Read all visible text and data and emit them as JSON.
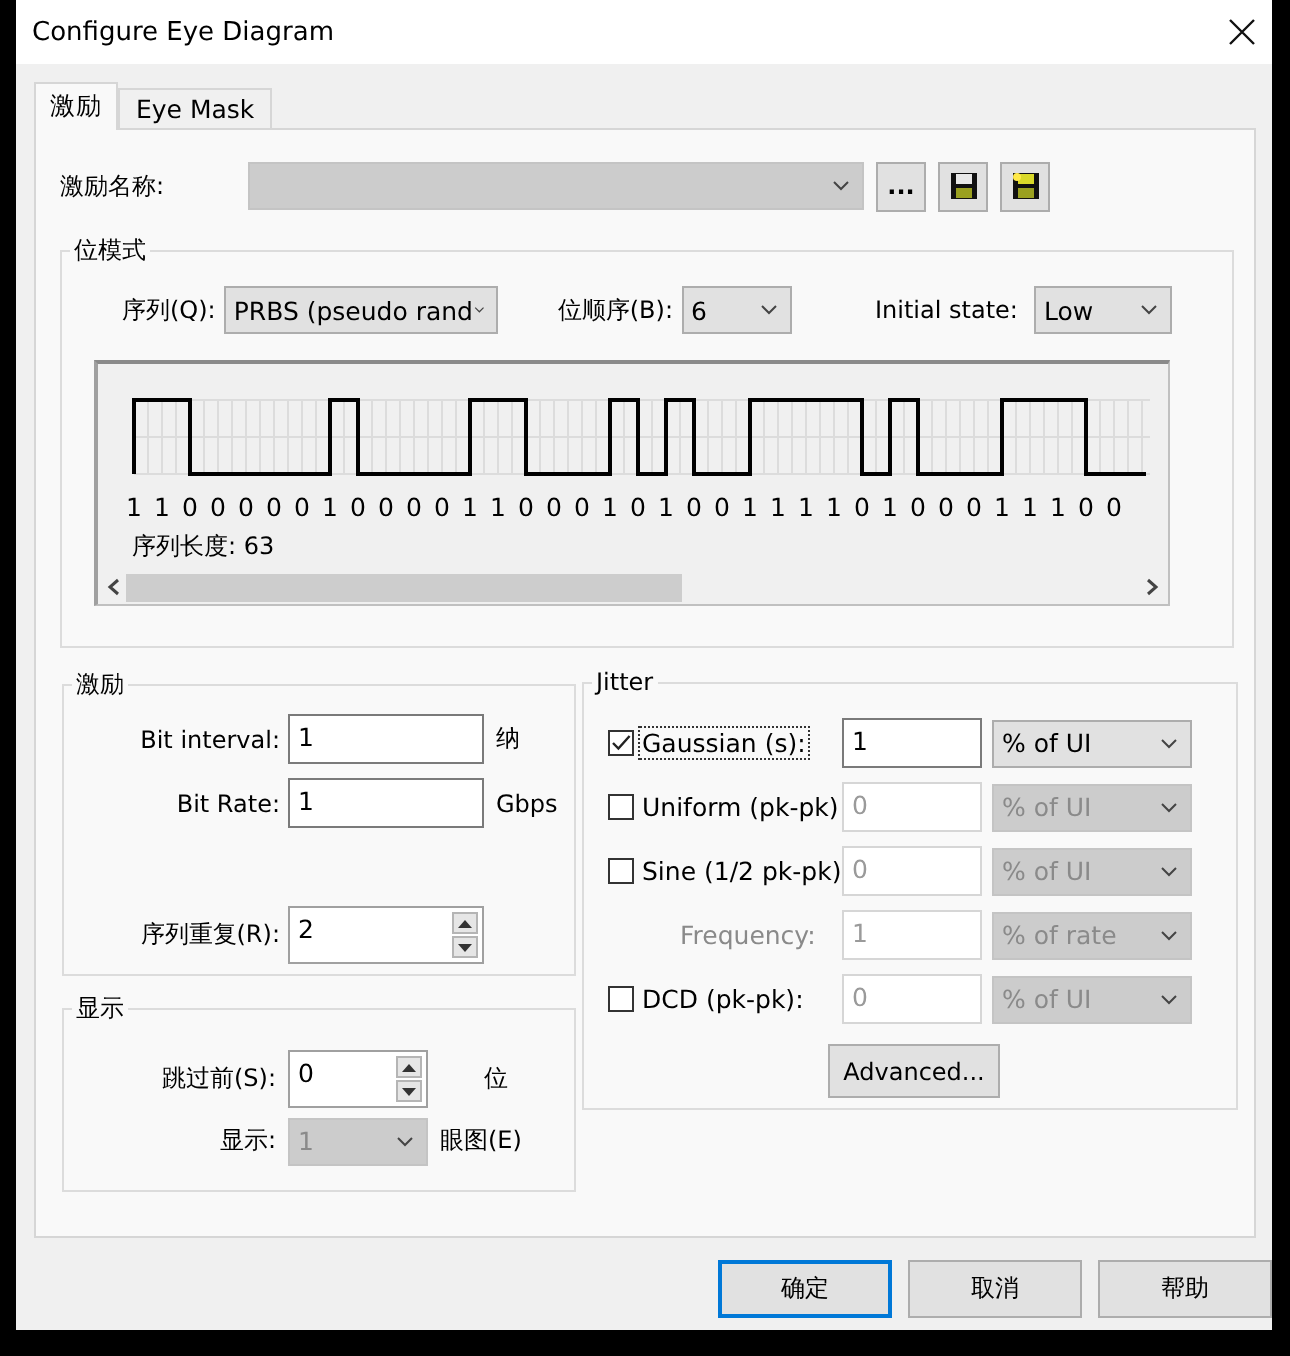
{
  "window": {
    "title": "Configure Eye Diagram"
  },
  "tabs": [
    {
      "label": "激励",
      "selected": true
    },
    {
      "label": "Eye Mask",
      "selected": false
    }
  ],
  "stimulus_name": {
    "label": "激励名称:",
    "disabled": true,
    "buttons": [
      {
        "kind": "text",
        "label": "..."
      },
      {
        "kind": "save"
      },
      {
        "kind": "save-as"
      }
    ]
  },
  "bit_pattern": {
    "title": "位模式",
    "sequence": {
      "label": "序列(Q):",
      "value": "PRBS (pseudo rand"
    },
    "bit_order": {
      "label": "位顺序(B):",
      "value": "6"
    },
    "initial_state": {
      "label": "Initial state:",
      "value": "Low"
    },
    "bits": [
      "1",
      "1",
      "0",
      "0",
      "0",
      "0",
      "0",
      "1",
      "0",
      "0",
      "0",
      "0",
      "1",
      "1",
      "0",
      "0",
      "0",
      "1",
      "0",
      "1",
      "0",
      "0",
      "1",
      "1",
      "1",
      "1",
      "0",
      "1",
      "0",
      "0",
      "0",
      "1",
      "1",
      "1",
      "0",
      "0"
    ],
    "length_label": "序列长度: 63"
  },
  "stimulus": {
    "title": "激励",
    "bit_interval": {
      "label": "Bit interval:",
      "value": "1",
      "unit": "纳"
    },
    "bit_rate": {
      "label": "Bit Rate:",
      "value": "1",
      "unit": "Gbps"
    },
    "repeat": {
      "label": "序列重复(R):",
      "value": "2"
    }
  },
  "display": {
    "title": "显示",
    "skip": {
      "label": "跳过前(S):",
      "value": "0",
      "unit": "位"
    },
    "show": {
      "label": "显示:",
      "value": "1",
      "unit": "眼图(E)",
      "disabled": true
    }
  },
  "jitter": {
    "title": "Jitter",
    "rows": [
      {
        "kind": "check",
        "label": "Gaussian (s):",
        "checked": true,
        "focused": true,
        "value": "1",
        "unit": "% of UI",
        "disabled": false
      },
      {
        "kind": "check",
        "label": "Uniform (pk-pk)",
        "checked": false,
        "focused": false,
        "value": "0",
        "unit": "% of UI",
        "disabled": true
      },
      {
        "kind": "check",
        "label": "Sine (1/2 pk-pk)",
        "checked": false,
        "focused": false,
        "value": "0",
        "unit": "% of UI",
        "disabled": true
      },
      {
        "kind": "label",
        "label": "Frequency:",
        "focused": false,
        "value": "1",
        "unit": "% of rate",
        "disabled": true
      },
      {
        "kind": "check",
        "label": "DCD (pk-pk):",
        "checked": false,
        "focused": false,
        "value": "0",
        "unit": "% of UI",
        "disabled": true
      }
    ],
    "advanced_button": "Advanced..."
  },
  "buttons": [
    {
      "label": "确定",
      "default": true
    },
    {
      "label": "取消",
      "default": false
    },
    {
      "label": "帮助",
      "default": false
    }
  ]
}
